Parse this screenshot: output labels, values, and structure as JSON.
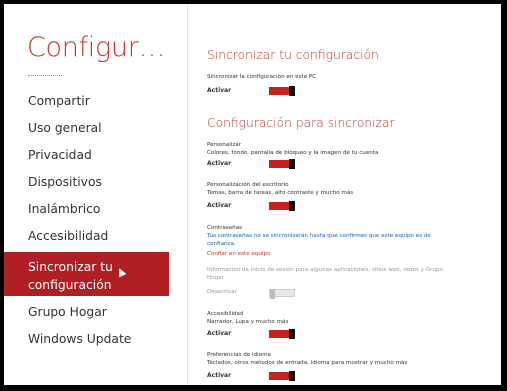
{
  "sidebar": {
    "title": "Configur…",
    "items": [
      {
        "label": "Compartir"
      },
      {
        "label": "Uso general"
      },
      {
        "label": "Privacidad"
      },
      {
        "label": "Dispositivos"
      },
      {
        "label": "Inalámbrico"
      },
      {
        "label": "Accesibilidad"
      },
      {
        "label_line1": "Sincronizar tu",
        "label_line2": "configuración",
        "selected": true
      },
      {
        "label": "Grupo Hogar"
      },
      {
        "label": "Windows Update"
      }
    ]
  },
  "main": {
    "sync_heading": "Sincronizar tu configuración",
    "sync_pc_label": "Sincronizar la configuración en este PC",
    "sync_pc_state": "Activar",
    "settings_heading": "Configuración para sincronizar",
    "personalize_title": "Personalizar",
    "personalize_desc": "Colores, fondo, pantalla de bloqueo y la imagen de tu cuenta",
    "personalize_state": "Activar",
    "desktop_title": "Personalización del escritorio",
    "desktop_desc": "Temas, barra de tareas, alto contraste y mucho más",
    "desktop_state": "Activar",
    "passwords_title": "Contraseñas",
    "passwords_notice_1": "Tus contraseñas no se sincronizarán hasta que confirmes que este equipo es de",
    "passwords_notice_2": "confianza.",
    "trust_link": "Confiar en este equipo",
    "signin_desc_1": "Información de inicio de sesión para algunas aplicaciones, sitios web, redes y Grupo",
    "signin_desc_2": "Hogar",
    "signin_state": "Desactivar",
    "accessibility_title": "Accesibilidad",
    "accessibility_desc": "Narrador, Lupa y mucho más",
    "accessibility_state": "Activar",
    "language_title": "Preferencias de idioma",
    "language_desc": "Teclados, otros métodos de entrada, idioma para mostrar y mucho más",
    "language_state": "Activar"
  },
  "colors": {
    "accent": "#c0392b",
    "selected_bg": "#b01f24",
    "link_blue": "#1a5fb4"
  }
}
